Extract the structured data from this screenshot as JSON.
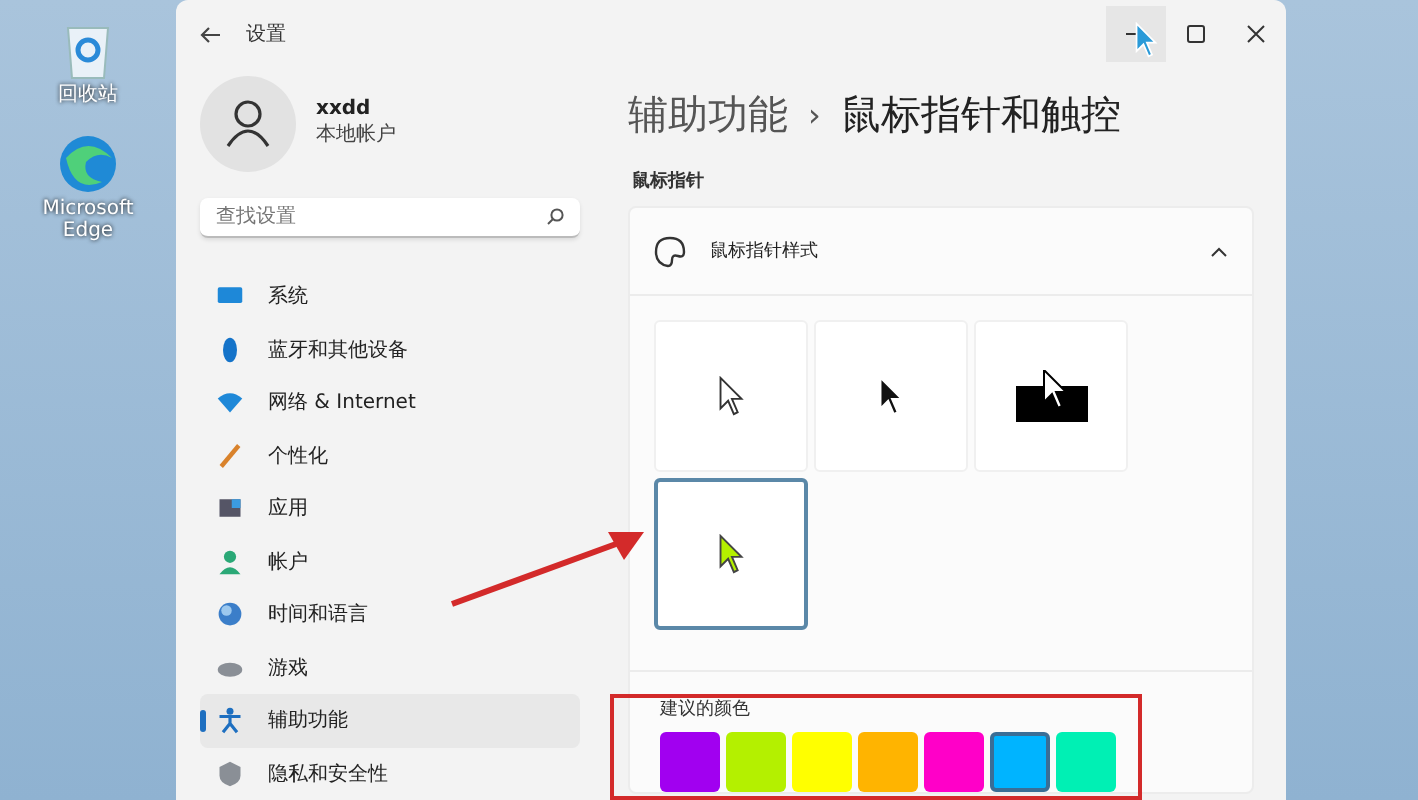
{
  "desktop": {
    "icons": [
      {
        "label": "回收站"
      },
      {
        "label": "Microsoft Edge"
      }
    ]
  },
  "window": {
    "title": "设置"
  },
  "account": {
    "name": "xxdd",
    "type": "本地帐户"
  },
  "search": {
    "placeholder": "查找设置"
  },
  "sidebar": {
    "items": [
      {
        "label": "系统",
        "selected": false
      },
      {
        "label": "蓝牙和其他设备",
        "selected": false
      },
      {
        "label": "网络 & Internet",
        "selected": false
      },
      {
        "label": "个性化",
        "selected": false
      },
      {
        "label": "应用",
        "selected": false
      },
      {
        "label": "帐户",
        "selected": false
      },
      {
        "label": "时间和语言",
        "selected": false
      },
      {
        "label": "游戏",
        "selected": false
      },
      {
        "label": "辅助功能",
        "selected": true
      },
      {
        "label": "隐私和安全性",
        "selected": false
      }
    ]
  },
  "breadcrumb": {
    "parent": "辅助功能",
    "separator": "›",
    "current": "鼠标指针和触控"
  },
  "section_title": "鼠标指针",
  "pointer_style": {
    "label": "鼠标指针样式",
    "expanded": true,
    "styles": [
      {
        "kind": "white",
        "selected": false
      },
      {
        "kind": "black",
        "selected": false
      },
      {
        "kind": "inverted",
        "selected": false
      },
      {
        "kind": "custom",
        "selected": true
      }
    ],
    "suggested_colors": {
      "label": "建议的颜色",
      "swatches": [
        {
          "color": "#a100f0",
          "selected": false
        },
        {
          "color": "#b4f000",
          "selected": false
        },
        {
          "color": "#ffff00",
          "selected": false
        },
        {
          "color": "#ffb400",
          "selected": false
        },
        {
          "color": "#ff00c8",
          "selected": false
        },
        {
          "color": "#00b4ff",
          "selected": true
        },
        {
          "color": "#00f0b4",
          "selected": false
        }
      ]
    }
  }
}
